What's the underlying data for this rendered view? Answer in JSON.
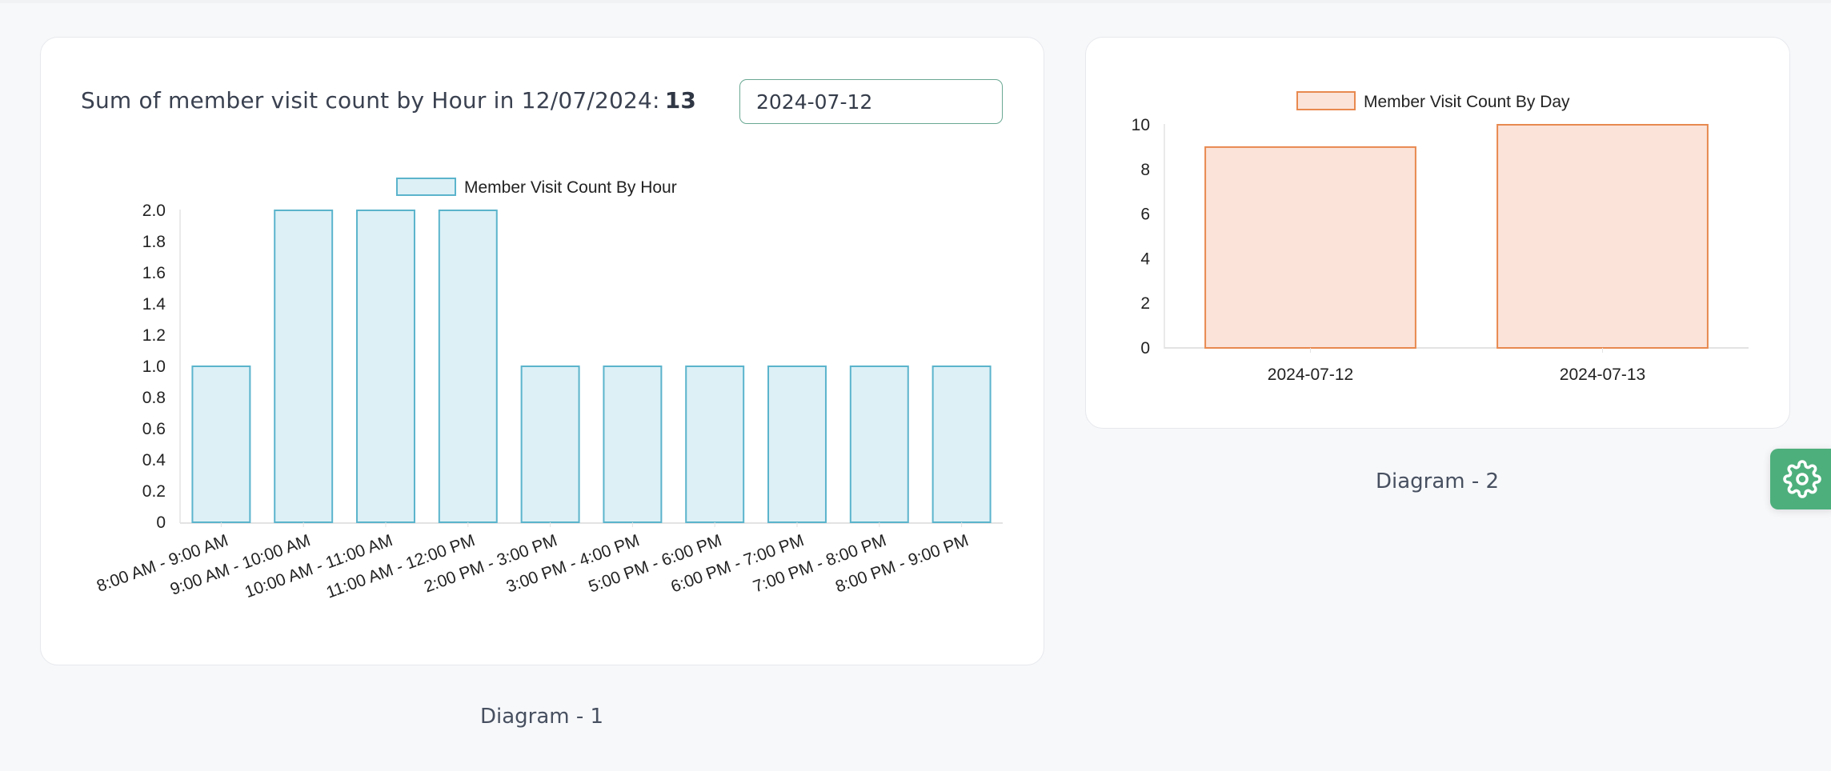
{
  "diagram1": {
    "summary_label": "Sum of member visit count by Hour in 12/07/2024:",
    "summary_total": "13",
    "date_input_value": "2024-07-12",
    "caption": "Diagram - 1"
  },
  "diagram2": {
    "caption": "Diagram - 2"
  },
  "settings_button": {
    "icon": "gear-icon",
    "color": "#4daf7c"
  },
  "chart_data": [
    {
      "type": "bar",
      "title": "",
      "legend": [
        "Member Visit Count By Hour"
      ],
      "legend_position": "top-center",
      "xlabel": "",
      "ylabel": "",
      "ylim": [
        0,
        2.0
      ],
      "yticks": [
        "0",
        "0.2",
        "0.4",
        "0.6",
        "0.8",
        "1.0",
        "1.2",
        "1.4",
        "1.6",
        "1.8",
        "2.0"
      ],
      "grid": false,
      "colors": {
        "fill": "#dcf0f6",
        "stroke": "#5bb4cc"
      },
      "categories": [
        "8:00 AM - 9:00 AM",
        "9:00 AM - 10:00 AM",
        "10:00 AM - 11:00 AM",
        "11:00 AM - 12:00 PM",
        "2:00 PM - 3:00 PM",
        "3:00 PM - 4:00 PM",
        "5:00 PM - 6:00 PM",
        "6:00 PM - 7:00 PM",
        "7:00 PM - 8:00 PM",
        "8:00 PM - 9:00 PM"
      ],
      "series": [
        {
          "name": "Member Visit Count By Hour",
          "values": [
            1,
            2,
            2,
            2,
            1,
            1,
            1,
            1,
            1,
            1
          ]
        }
      ]
    },
    {
      "type": "bar",
      "title": "",
      "legend": [
        "Member Visit Count By Day"
      ],
      "legend_position": "top-center",
      "xlabel": "",
      "ylabel": "",
      "ylim": [
        0,
        10
      ],
      "yticks": [
        "0",
        "2",
        "4",
        "6",
        "8",
        "10"
      ],
      "grid": false,
      "colors": {
        "fill": "#fbe3d9",
        "stroke": "#e8894f"
      },
      "categories": [
        "2024-07-12",
        "2024-07-13"
      ],
      "series": [
        {
          "name": "Member Visit Count By Day",
          "values": [
            9,
            10
          ]
        }
      ]
    }
  ]
}
